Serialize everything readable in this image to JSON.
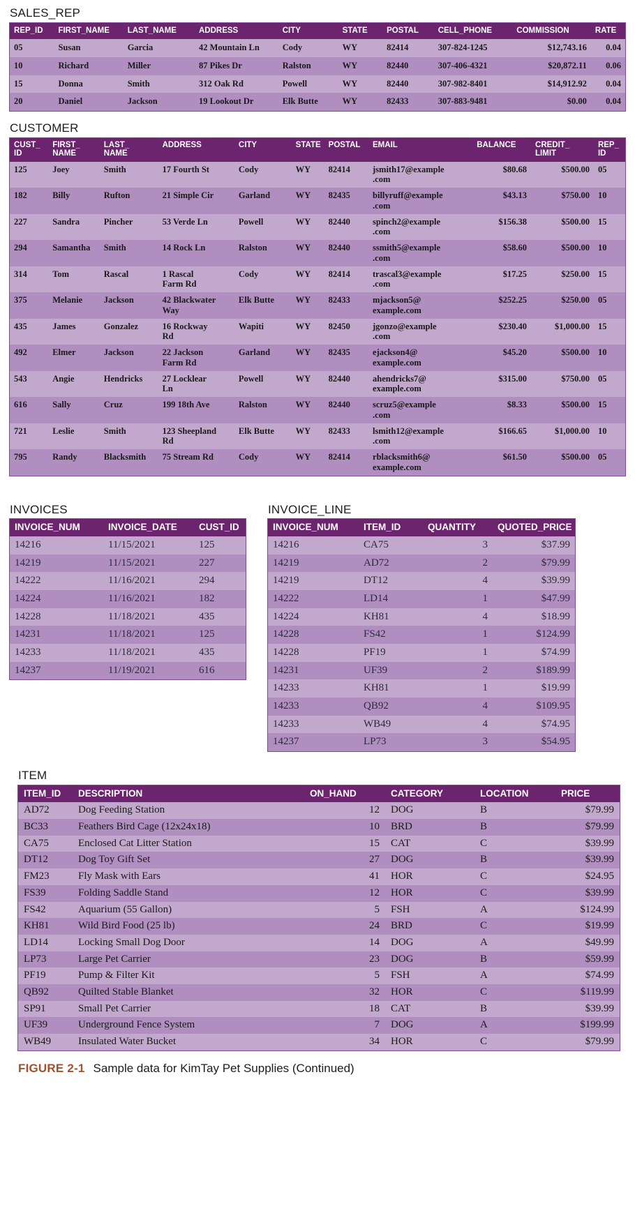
{
  "figure": {
    "label": "FIGURE 2-1",
    "text": "Sample data for KimTay Pet Supplies (Continued)"
  },
  "colors": {
    "header_purple": "#6b246d",
    "row_light": "#c3a8cd",
    "row_dark": "#b08ec0",
    "caption_label": "#a0522d"
  },
  "sales_rep": {
    "title": "SALES_REP",
    "columns": [
      "REP_ID",
      "FIRST_NAME",
      "LAST_NAME",
      "ADDRESS",
      "CITY",
      "STATE",
      "POSTAL",
      "CELL_PHONE",
      "COMMISSION",
      "RATE"
    ],
    "rows": [
      [
        "05",
        "Susan",
        "Garcia",
        "42 Mountain Ln",
        "Cody",
        "WY",
        "82414",
        "307-824-1245",
        "$12,743.16",
        "0.04"
      ],
      [
        "10",
        "Richard",
        "Miller",
        "87 Pikes Dr",
        "Ralston",
        "WY",
        "82440",
        "307-406-4321",
        "$20,872.11",
        "0.06"
      ],
      [
        "15",
        "Donna",
        "Smith",
        "312 Oak Rd",
        "Powell",
        "WY",
        "82440",
        "307-982-8401",
        "$14,912.92",
        "0.04"
      ],
      [
        "20",
        "Daniel",
        "Jackson",
        "19 Lookout Dr",
        "Elk Butte",
        "WY",
        "82433",
        "307-883-9481",
        "$0.00",
        "0.04"
      ]
    ]
  },
  "customer": {
    "title": "CUSTOMER",
    "columns": [
      "CUST_\nID",
      "FIRST_\nNAME",
      "LAST_\nNAME",
      "ADDRESS",
      "CITY",
      "STATE",
      "POSTAL",
      "EMAIL",
      "BALANCE",
      "CREDIT_\nLIMIT",
      "REP_\nID"
    ],
    "rows": [
      [
        "125",
        "Joey",
        "Smith",
        "17 Fourth St",
        "Cody",
        "WY",
        "82414",
        "jsmith17@example\n.com",
        "$80.68",
        "$500.00",
        "05"
      ],
      [
        "182",
        "Billy",
        "Rufton",
        "21 Simple Cir",
        "Garland",
        "WY",
        "82435",
        "billyruff@example\n.com",
        "$43.13",
        "$750.00",
        "10"
      ],
      [
        "227",
        "Sandra",
        "Pincher",
        "53 Verde Ln",
        "Powell",
        "WY",
        "82440",
        "spinch2@example\n.com",
        "$156.38",
        "$500.00",
        "15"
      ],
      [
        "294",
        "Samantha",
        "Smith",
        "14 Rock Ln",
        "Ralston",
        "WY",
        "82440",
        "ssmith5@example\n.com",
        "$58.60",
        "$500.00",
        "10"
      ],
      [
        "314",
        "Tom",
        "Rascal",
        "1 Rascal\nFarm Rd",
        "Cody",
        "WY",
        "82414",
        "trascal3@example\n.com",
        "$17.25",
        "$250.00",
        "15"
      ],
      [
        "375",
        "Melanie",
        "Jackson",
        "42 Blackwater\nWay",
        "Elk Butte",
        "WY",
        "82433",
        "mjackson5@\nexample.com",
        "$252.25",
        "$250.00",
        "05"
      ],
      [
        "435",
        "James",
        "Gonzalez",
        "16 Rockway\nRd",
        "Wapiti",
        "WY",
        "82450",
        "jgonzo@example\n.com",
        "$230.40",
        "$1,000.00",
        "15"
      ],
      [
        "492",
        "Elmer",
        "Jackson",
        "22 Jackson\nFarm Rd",
        "Garland",
        "WY",
        "82435",
        "ejackson4@\nexample.com",
        "$45.20",
        "$500.00",
        "10"
      ],
      [
        "543",
        "Angie",
        "Hendricks",
        "27 Locklear\nLn",
        "Powell",
        "WY",
        "82440",
        "ahendricks7@\nexample.com",
        "$315.00",
        "$750.00",
        "05"
      ],
      [
        "616",
        "Sally",
        "Cruz",
        "199 18th Ave",
        "Ralston",
        "WY",
        "82440",
        "scruz5@example\n.com",
        "$8.33",
        "$500.00",
        "15"
      ],
      [
        "721",
        "Leslie",
        "Smith",
        "123 Sheepland\nRd",
        "Elk Butte",
        "WY",
        "82433",
        "lsmith12@example\n.com",
        "$166.65",
        "$1,000.00",
        "10"
      ],
      [
        "795",
        "Randy",
        "Blacksmith",
        "75 Stream Rd",
        "Cody",
        "WY",
        "82414",
        "rblacksmith6@\nexample.com",
        "$61.50",
        "$500.00",
        "05"
      ]
    ]
  },
  "invoices": {
    "title": "INVOICES",
    "columns": [
      "INVOICE_NUM",
      "INVOICE_DATE",
      "CUST_ID"
    ],
    "rows": [
      [
        "14216",
        "11/15/2021",
        "125"
      ],
      [
        "14219",
        "11/15/2021",
        "227"
      ],
      [
        "14222",
        "11/16/2021",
        "294"
      ],
      [
        "14224",
        "11/16/2021",
        "182"
      ],
      [
        "14228",
        "11/18/2021",
        "435"
      ],
      [
        "14231",
        "11/18/2021",
        "125"
      ],
      [
        "14233",
        "11/18/2021",
        "435"
      ],
      [
        "14237",
        "11/19/2021",
        "616"
      ]
    ]
  },
  "invoice_line": {
    "title": "INVOICE_LINE",
    "columns": [
      "INVOICE_NUM",
      "ITEM_ID",
      "QUANTITY",
      "QUOTED_PRICE"
    ],
    "rows": [
      [
        "14216",
        "CA75",
        "3",
        "$37.99"
      ],
      [
        "14219",
        "AD72",
        "2",
        "$79.99"
      ],
      [
        "14219",
        "DT12",
        "4",
        "$39.99"
      ],
      [
        "14222",
        "LD14",
        "1",
        "$47.99"
      ],
      [
        "14224",
        "KH81",
        "4",
        "$18.99"
      ],
      [
        "14228",
        "FS42",
        "1",
        "$124.99"
      ],
      [
        "14228",
        "PF19",
        "1",
        "$74.99"
      ],
      [
        "14231",
        "UF39",
        "2",
        "$189.99"
      ],
      [
        "14233",
        "KH81",
        "1",
        "$19.99"
      ],
      [
        "14233",
        "QB92",
        "4",
        "$109.95"
      ],
      [
        "14233",
        "WB49",
        "4",
        "$74.95"
      ],
      [
        "14237",
        "LP73",
        "3",
        "$54.95"
      ]
    ]
  },
  "item": {
    "title": "ITEM",
    "columns": [
      "ITEM_ID",
      "DESCRIPTION",
      "ON_HAND",
      "CATEGORY",
      "LOCATION",
      "PRICE"
    ],
    "rows": [
      [
        "AD72",
        "Dog Feeding Station",
        "12",
        "DOG",
        "B",
        "$79.99"
      ],
      [
        "BC33",
        "Feathers Bird Cage (12x24x18)",
        "10",
        "BRD",
        "B",
        "$79.99"
      ],
      [
        "CA75",
        "Enclosed Cat Litter Station",
        "15",
        "CAT",
        "C",
        "$39.99"
      ],
      [
        "DT12",
        "Dog Toy Gift Set",
        "27",
        "DOG",
        "B",
        "$39.99"
      ],
      [
        "FM23",
        "Fly Mask with Ears",
        "41",
        "HOR",
        "C",
        "$24.95"
      ],
      [
        "FS39",
        "Folding Saddle Stand",
        "12",
        "HOR",
        "C",
        "$39.99"
      ],
      [
        "FS42",
        "Aquarium (55 Gallon)",
        "5",
        "FSH",
        "A",
        "$124.99"
      ],
      [
        "KH81",
        "Wild Bird Food (25 lb)",
        "24",
        "BRD",
        "C",
        "$19.99"
      ],
      [
        "LD14",
        "Locking Small Dog Door",
        "14",
        "DOG",
        "A",
        "$49.99"
      ],
      [
        "LP73",
        "Large Pet Carrier",
        "23",
        "DOG",
        "B",
        "$59.99"
      ],
      [
        "PF19",
        "Pump & Filter Kit",
        "5",
        "FSH",
        "A",
        "$74.99"
      ],
      [
        "QB92",
        "Quilted Stable Blanket",
        "32",
        "HOR",
        "C",
        "$119.99"
      ],
      [
        "SP91",
        "Small Pet Carrier",
        "18",
        "CAT",
        "B",
        "$39.99"
      ],
      [
        "UF39",
        "Underground Fence System",
        "7",
        "DOG",
        "A",
        "$199.99"
      ],
      [
        "WB49",
        "Insulated Water Bucket",
        "34",
        "HOR",
        "C",
        "$79.99"
      ]
    ]
  }
}
